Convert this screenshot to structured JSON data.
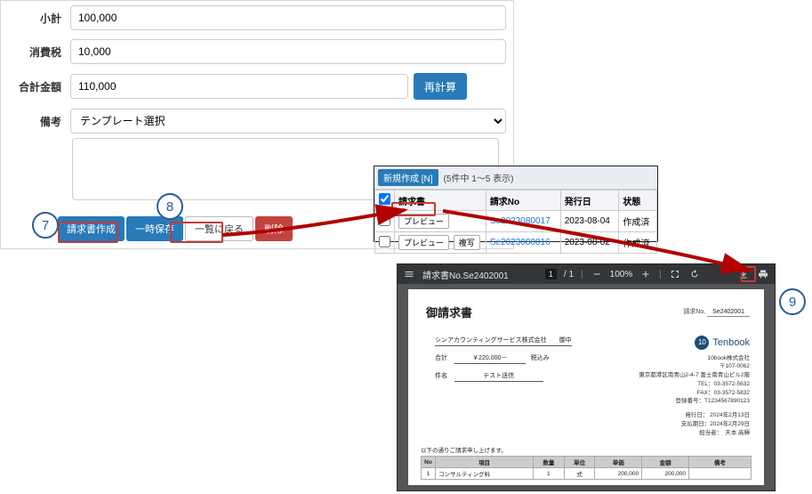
{
  "form": {
    "labels": {
      "subtotal": "小計",
      "tax": "消費税",
      "total": "合計金額",
      "remarks": "備考"
    },
    "values": {
      "subtotal": "100,000",
      "tax": "10,000",
      "total": "110,000"
    },
    "recalc": "再計算",
    "template_placeholder": "テンプレート選択",
    "buttons": {
      "create": "請求書作成",
      "save": "一時保存",
      "back": "一覧に戻る",
      "delete": "削除"
    }
  },
  "list": {
    "new_button": "新規作成 [N]",
    "count_text": "(5件中 1〜5 表示)",
    "columns": {
      "c1": "請求書",
      "c2": "請求No",
      "c3": "発行日",
      "c4": "状態"
    },
    "mini_preview": "プレビュー",
    "mini_copy": "複写",
    "rows": [
      {
        "no": "Se2023080017",
        "date": "2023-08-04",
        "status": "作成済"
      },
      {
        "no": "Se2023080016",
        "date": "2023-08-02",
        "status": "作成済"
      }
    ]
  },
  "pdf": {
    "title_bar": "請求書No.Se2402001",
    "page_current": "1",
    "page_total": "/ 1",
    "zoom": "100%",
    "doc": {
      "title": "御請求書",
      "invoice_no_label": "請求No.",
      "invoice_no_value": "Se2402001",
      "recipient": "シンアカウンティングサービス株式会社　　御中",
      "total_label": "合計",
      "total_value": "￥220,000－",
      "tax_incl": "税込み",
      "subject_label": "件名",
      "subject_value": "テスト送信",
      "company_name": "10book株式会社",
      "company_post": "〒107-0062",
      "company_addr": "東京都港区南青山2-4-7 富士南青山ビル2階",
      "company_tel": "TEL：03-3572-5632",
      "company_fax": "FAX：03-3572-5832",
      "company_reg": "登録番号：T1234567890123",
      "issue_date": "発行日： 2024年2月13日",
      "due_date": "支払期日：2024年2月29日",
      "staff": "担当者：　天本 高輝",
      "brand": "Tenbook",
      "brand_circ": "10",
      "note": "以下の通りご請求申し上げます。",
      "tbl_headers": {
        "no": "No",
        "item": "項目",
        "qty": "数量",
        "unit": "単位",
        "price": "単価",
        "amount": "金額",
        "remarks": "備考"
      },
      "tbl_row": {
        "no": "1",
        "item": "コンサルティング料",
        "qty": "1",
        "unit": "式",
        "price": "200,000",
        "amount": "200,000",
        "remarks": ""
      }
    }
  },
  "steps": {
    "s7": "7",
    "s8": "8",
    "s9": "9"
  }
}
